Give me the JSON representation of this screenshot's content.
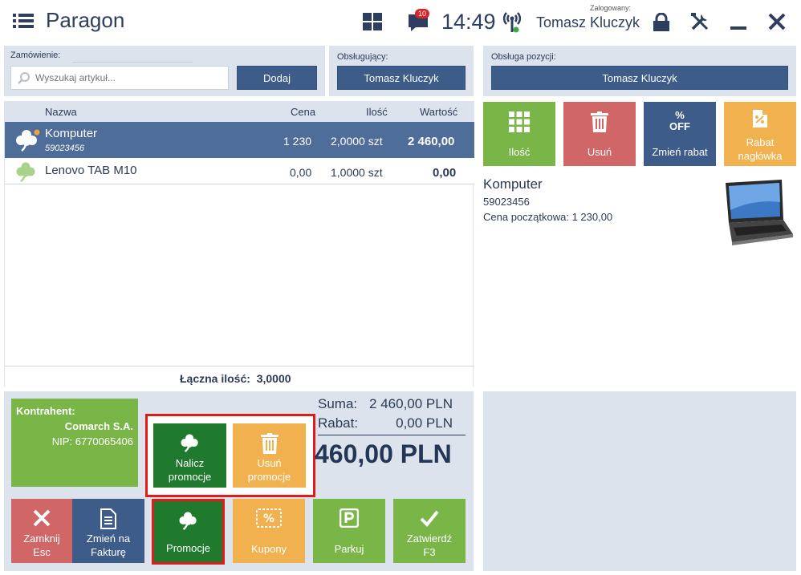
{
  "header": {
    "title": "Paragon",
    "notification_count": "10",
    "clock": "14:49",
    "logged_label": "Zalogowany:",
    "user": "Tomasz Kluczyk"
  },
  "order": {
    "label": "Zamówienie:",
    "search_placeholder": "Wyszukaj artykuł...",
    "add_button": "Dodaj"
  },
  "served_by": {
    "label": "Obsługujący:",
    "value": "Tomasz Kluczyk"
  },
  "position_service": {
    "label": "Obsługa pozycji:",
    "value": "Tomasz Kluczyk"
  },
  "table": {
    "headers": {
      "name": "Nazwa",
      "price": "Cena",
      "qty": "Ilość",
      "value": "Wartość"
    },
    "rows": [
      {
        "name": "Komputer",
        "code": "59023456",
        "price": "1 230",
        "qty": "2,0000 szt",
        "value": "2 460,00"
      },
      {
        "name": "Lenovo TAB M10",
        "code": "",
        "price": "0,00",
        "qty": "1,0000 szt",
        "value": "0,00"
      }
    ],
    "total_label": "Łączna ilość:",
    "total_value": "3,0000"
  },
  "position_actions": {
    "qty": "Ilość",
    "delete": "Usuń",
    "discount_line1": "% ",
    "discount_line2": "OFF",
    "discount": "Zmień rabat",
    "header_discount_1": "Rabat",
    "header_discount_2": "nagłówka"
  },
  "detail": {
    "name": "Komputer",
    "code": "59023456",
    "start_price": "Cena początkowa: 1 230,00"
  },
  "contractor": {
    "label": "Kontrahent:",
    "name": "Comarch S.A.",
    "nip": "NIP: 6770065406"
  },
  "promo_popup": {
    "apply_1": "Nalicz",
    "apply_2": "promocje",
    "remove_1": "Usuń",
    "remove_2": "promocje"
  },
  "summary": {
    "sum_label": "Suma:",
    "sum_value": "2 460,00 PLN",
    "discount_label": "Rabat:",
    "discount_value": "0,00 PLN",
    "total": "460,00 PLN"
  },
  "bottom": {
    "close_1": "Zamknij",
    "close_2": "Esc",
    "invoice_1": "Zmień na",
    "invoice_2": "Fakturę",
    "promotions": "Promocje",
    "coupons": "Kupony",
    "park": "Parkuj",
    "confirm_1": "Zatwierdź",
    "confirm_2": "F3"
  },
  "colors": {
    "navy": "#3e5c8a",
    "green": "#7ab548",
    "dark_green": "#1f7a2e",
    "red": "#d06666",
    "orange": "#f0b14e",
    "highlight": "#e01b1b"
  }
}
